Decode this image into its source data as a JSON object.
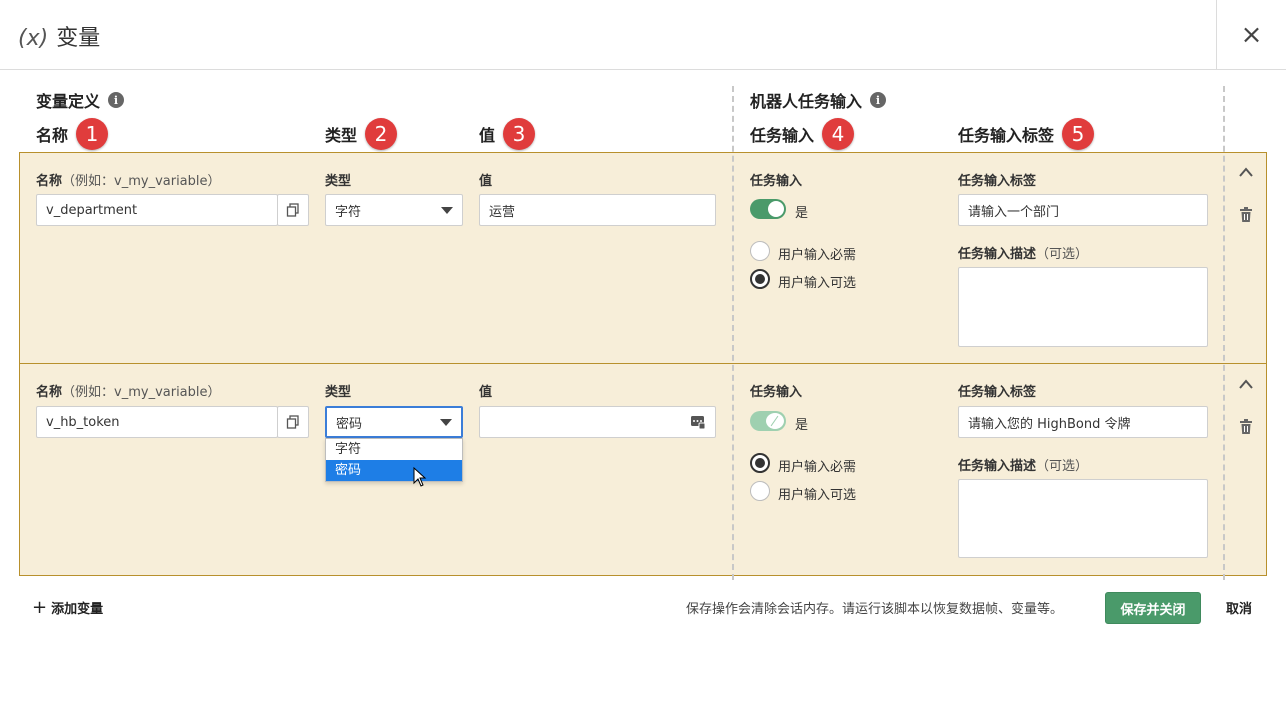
{
  "header": {
    "icon": "(x)",
    "title": "变量",
    "close": "×"
  },
  "sections": {
    "variable_definition": "变量定义",
    "robot_task_input": "机器人任务输入"
  },
  "columns": {
    "name": "名称",
    "type": "类型",
    "value": "值",
    "task_input": "任务输入",
    "task_input_label": "任务输入标签"
  },
  "badges": [
    "1",
    "2",
    "3",
    "4",
    "5"
  ],
  "field_labels": {
    "name": "名称",
    "name_hint": "（例如：v_my_variable）",
    "type": "类型",
    "value": "值",
    "task_input": "任务输入",
    "task_input_label": "任务输入标签",
    "task_input_desc": "任务输入描述",
    "optional_hint": "（可选）",
    "toggle_yes": "是",
    "radio_required": "用户输入必需",
    "radio_optional": "用户输入可选"
  },
  "rows": [
    {
      "name": "v_department",
      "type": "字符",
      "value": "运营",
      "task_input_enabled": true,
      "user_input": "optional",
      "task_input_label": "请输入一个部门",
      "task_input_desc": ""
    },
    {
      "name": "v_hb_token",
      "type": "密码",
      "value": "",
      "task_input_enabled": true,
      "toggle_disabled": true,
      "user_input": "required",
      "task_input_label": "请输入您的 HighBond 令牌",
      "task_input_desc": ""
    }
  ],
  "type_dropdown": {
    "options": [
      "字符",
      "密码"
    ],
    "selected": "密码"
  },
  "footer": {
    "add_variable": "添加变量",
    "note": "保存操作会清除会话内存。请运行该脚本以恢复数据帧、变量等。",
    "save": "保存并关闭",
    "cancel": "取消"
  },
  "colors": {
    "accent_green": "#4a9a6a",
    "row_bg": "#f7eed9",
    "row_border": "#b8902c",
    "badge_red": "#e03c3c",
    "selection_blue": "#1e7ee6"
  }
}
